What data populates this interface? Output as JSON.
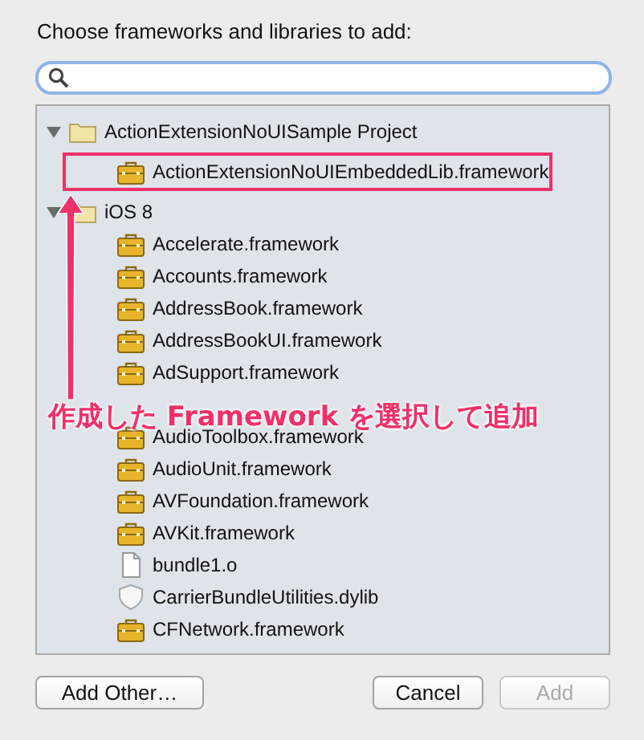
{
  "prompt": "Choose frameworks and libraries to add:",
  "tree": [
    {
      "kind": "folder",
      "label": "ActionExtensionNoUISample Project",
      "expanded": true,
      "children": [
        {
          "kind": "framework",
          "label": "ActionExtensionNoUIEmbeddedLib.framework",
          "highlighted": true
        }
      ]
    },
    {
      "kind": "folder",
      "label": "iOS 8",
      "expanded": true,
      "children": [
        {
          "kind": "framework",
          "label": "Accelerate.framework",
          "highlighted": false
        },
        {
          "kind": "framework",
          "label": "Accounts.framework",
          "highlighted": false
        },
        {
          "kind": "framework",
          "label": "AddressBook.framework",
          "highlighted": false
        },
        {
          "kind": "framework",
          "label": "AddressBookUI.framework",
          "highlighted": false
        },
        {
          "kind": "framework",
          "label": "AdSupport.framework",
          "highlighted": false
        },
        {
          "highlighted": false
        },
        {
          "kind": "framework",
          "label": "AudioToolbox.framework",
          "highlighted": false
        },
        {
          "kind": "framework",
          "label": "AudioUnit.framework",
          "highlighted": false
        },
        {
          "kind": "framework",
          "label": "AVFoundation.framework",
          "highlighted": false
        },
        {
          "kind": "framework",
          "label": "AVKit.framework",
          "highlighted": false
        },
        {
          "kind": "file",
          "label": "bundle1.o",
          "highlighted": false
        },
        {
          "kind": "library",
          "label": "CarrierBundleUtilities.dylib",
          "highlighted": false
        },
        {
          "kind": "framework",
          "label": "CFNetwork.framework",
          "highlighted": false
        }
      ]
    }
  ],
  "annotation": "作成した **Framework** を選択して追加",
  "buttons": [
    {
      "label": "Add Other…",
      "disabled": false
    },
    {
      "label": "Cancel",
      "disabled": false
    },
    {
      "label": "Add",
      "disabled": true
    }
  ]
}
